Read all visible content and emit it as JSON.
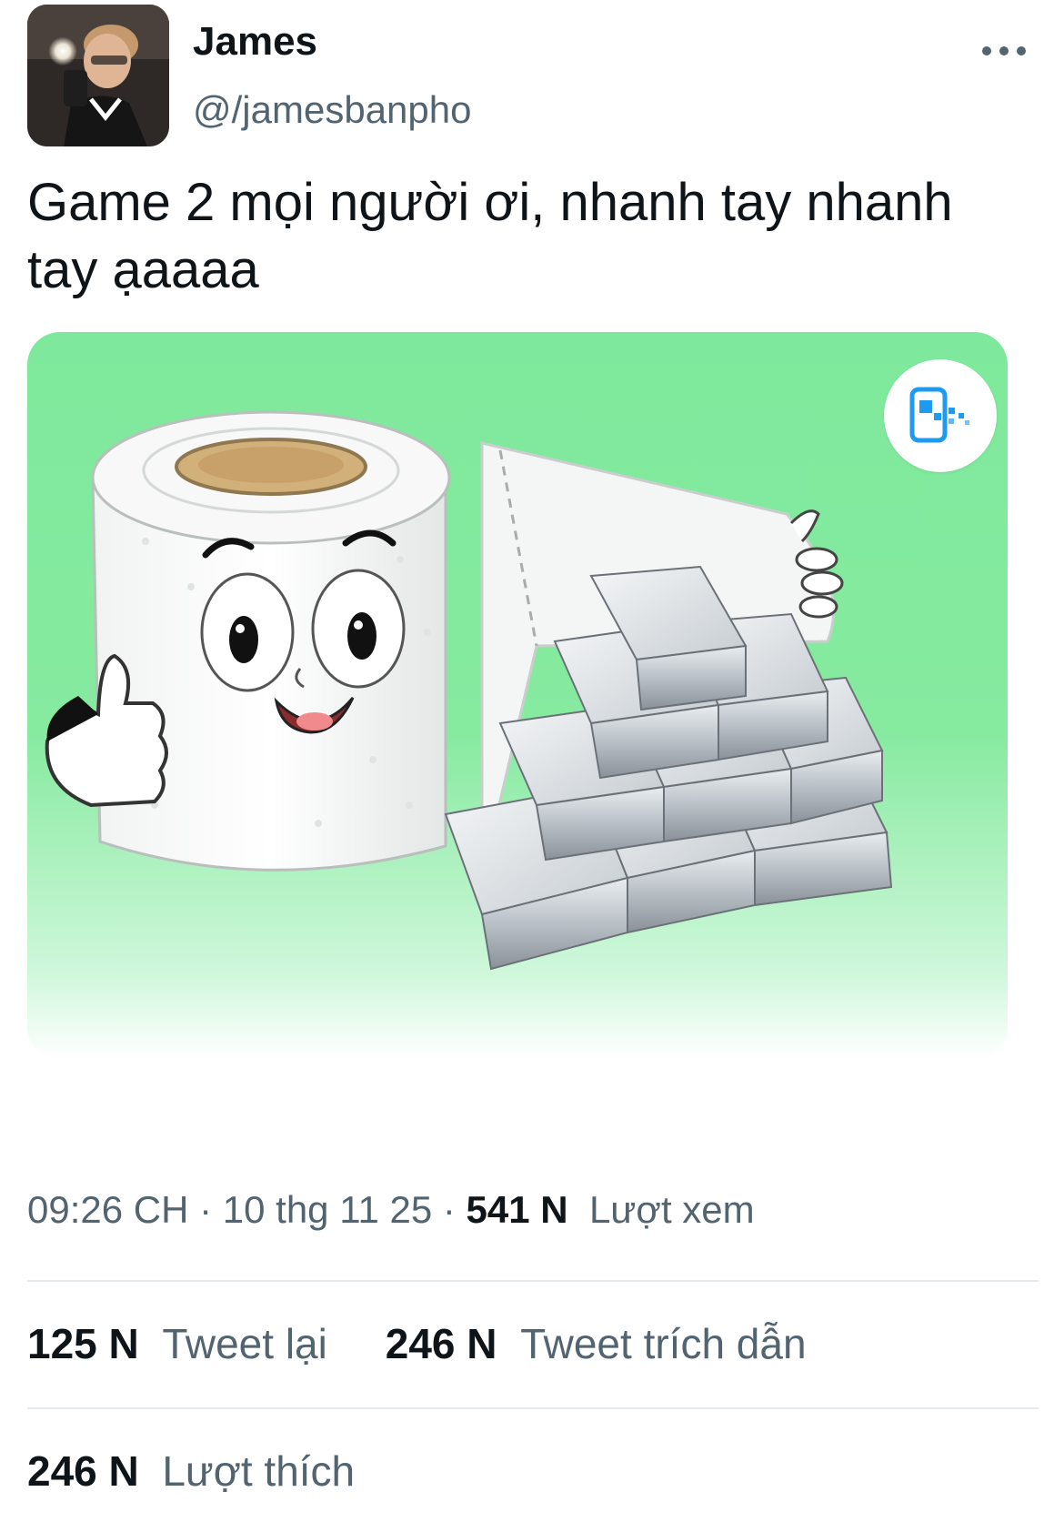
{
  "author": {
    "name": "James",
    "handle": "@/jamesbanpho"
  },
  "tweet": {
    "text": "Game 2 mọi người ơi, nhanh tay nhanh tay ạaaaa"
  },
  "media": {
    "background_color": "#86ea9f",
    "mini_app_icon": "mini-app-icon"
  },
  "meta": {
    "time": "09:26 CH",
    "date": "10 thg 11 25",
    "views_count": "541 N",
    "views_label": "Lượt xem"
  },
  "stats": {
    "retweets_count": "125 N",
    "retweets_label": "Tweet lại",
    "quotes_count": "246 N",
    "quotes_label": "Tweet trích dẫn",
    "likes_count": "246 N",
    "likes_label": "Lượt thích"
  },
  "colors": {
    "text_primary": "#0f1419",
    "text_secondary": "#536471",
    "divider": "#e4e9ed",
    "accent_blue": "#1d9bf0"
  }
}
